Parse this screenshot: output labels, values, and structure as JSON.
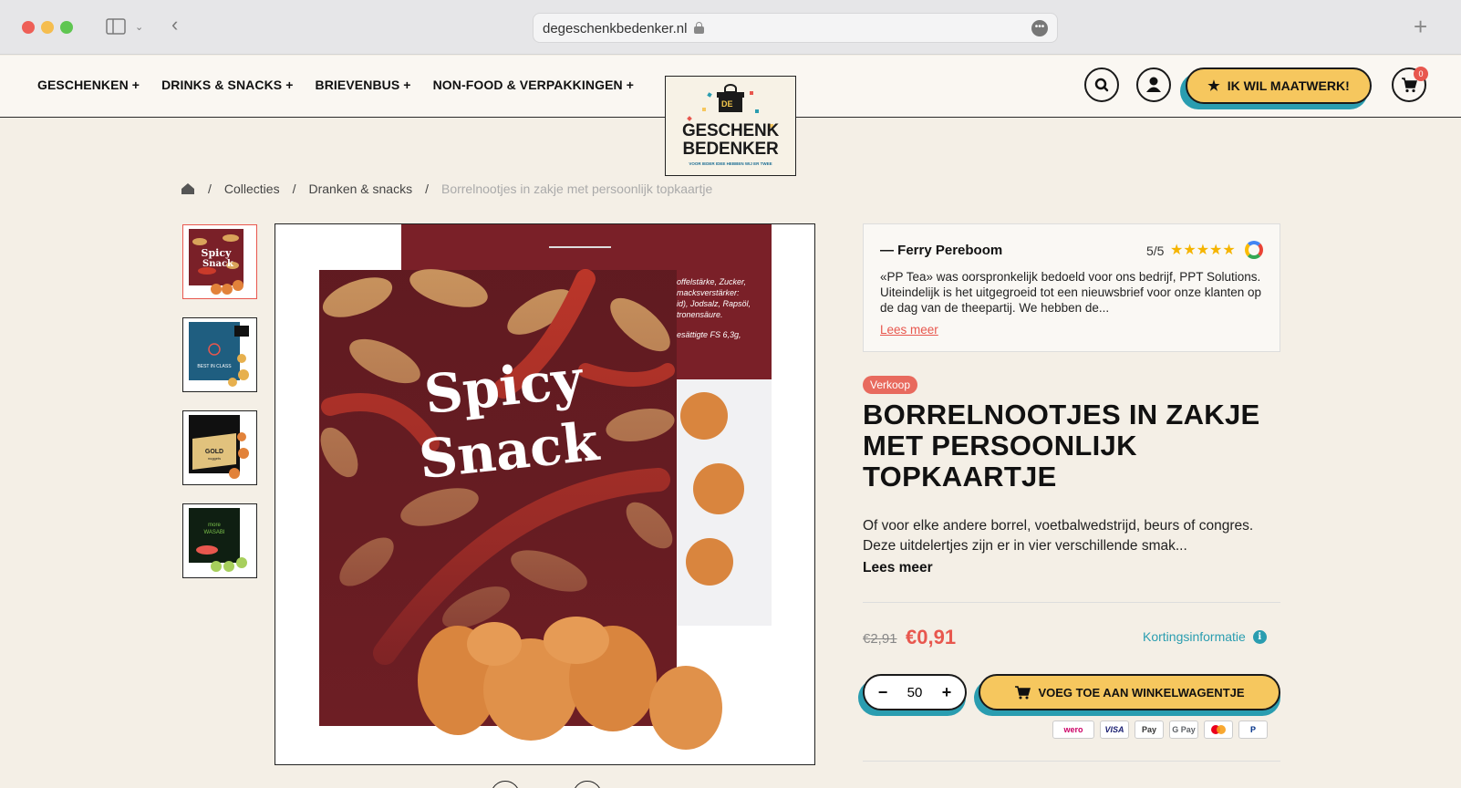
{
  "browser": {
    "url": "degeschenkbedenker.nl"
  },
  "nav": {
    "items": [
      {
        "label": "GESCHENKEN +"
      },
      {
        "label": "DRINKS & SNACKS +"
      },
      {
        "label": "BRIEVENBUS +"
      },
      {
        "label": "NON-FOOD & VERPAKKINGEN +"
      }
    ]
  },
  "logo": {
    "badge": "DE",
    "line1": "GESCHENK",
    "line2": "BEDENKER",
    "tagline": "VOOR IEDER IDEE HEBBEN WIJ ER TWEE"
  },
  "header": {
    "maatwerk_label": "IK WIL MAATWERK!",
    "cart_count": "0"
  },
  "breadcrumb": {
    "items": [
      "Collecties",
      "Dranken & snacks"
    ],
    "current": "Borrelnootjes in zakje met persoonlijk topkaartje",
    "separator": "/"
  },
  "gallery": {
    "thumbnails": [
      {
        "label": "Spicy Snack",
        "colors": [
          "#7a2028",
          "#d9a35a"
        ]
      },
      {
        "label": "BEST IN CLASS",
        "colors": [
          "#1f5e80",
          "#e7b04e"
        ]
      },
      {
        "label": "GOLD nuggets",
        "colors": [
          "#101010",
          "#e1c27d"
        ]
      },
      {
        "label": "more WASABI",
        "colors": [
          "#0f1f12",
          "#a7cf5c"
        ]
      }
    ],
    "main": {
      "title_line1": "Spicy",
      "title_line2": "Snack",
      "back_text": "offelstärke, Zucker, macksverstärker: id), Jodsalz, Rapsöl, tronensäure. n. esättigte FS 6,3g,"
    }
  },
  "review": {
    "author": "— Ferry Pereboom",
    "score": "5/5",
    "stars": "★★★★★",
    "text": "«PP Tea» was oorspronkelijk bedoeld voor ons bedrijf, PPT Solutions. Uiteindelijk is het uitgegroeid tot een nieuwsbrief voor onze klanten op de dag van de theepartij. We hebben de...",
    "more_label": "Lees meer"
  },
  "product": {
    "badge": "Verkoop",
    "title": "BORRELNOOTJES IN ZAKJE MET PERSOONLIJK TOPKAARTJE",
    "description": "Of voor elke andere borrel, voetbalwedstrijd, beurs of congres. Deze uitdelertjes zijn er in vier verschillende smak...",
    "read_more": "Lees meer",
    "old_price": "€2,91",
    "price": "€0,91",
    "discount_info": "Kortingsinformatie",
    "quantity": "50",
    "add_to_cart": "VOEG TOE AAN WINKELWAGENTJE"
  },
  "payments": [
    "wero",
    "VISA",
    "Pay",
    "G Pay",
    "",
    "P"
  ],
  "colors": {
    "accent_yellow": "#f6c75e",
    "accent_teal": "#2a9db0",
    "accent_red": "#e8574e",
    "background": "#f4efe6"
  }
}
